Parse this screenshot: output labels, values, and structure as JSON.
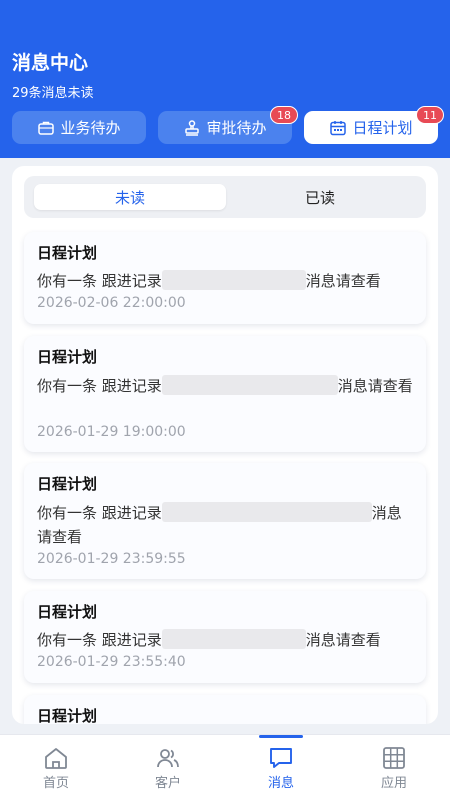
{
  "header": {
    "title": "消息中心",
    "subtitle": "29条消息未读"
  },
  "tabs": [
    {
      "label": "业务待办",
      "icon": "briefcase-icon",
      "badge": null,
      "active": false
    },
    {
      "label": "审批待办",
      "icon": "stamp-icon",
      "badge": "18",
      "active": false
    },
    {
      "label": "日程计划",
      "icon": "calendar-icon",
      "badge": "11",
      "active": true
    }
  ],
  "segment": {
    "unread": "未读",
    "read": "已读",
    "selected": "未读"
  },
  "messages": [
    {
      "title": "日程计划",
      "prefix": "你有一条 跟进记录",
      "suffix": "消息请查看",
      "time": "2026-02-06 22:00:00"
    },
    {
      "title": "日程计划",
      "prefix": "你有一条 跟进记录",
      "suffix": "消息请查看",
      "time": "2026-01-29 19:00:00"
    },
    {
      "title": "日程计划",
      "prefix": "你有一条 跟进记录",
      "suffix": "消息请查看",
      "time": "2026-01-29 23:59:55"
    },
    {
      "title": "日程计划",
      "prefix": "你有一条 跟进记录",
      "suffix": "消息请查看",
      "time": "2026-01-29 23:55:40"
    },
    {
      "title": "日程计划"
    }
  ],
  "nav": [
    {
      "label": "首页",
      "icon": "home-icon",
      "active": false
    },
    {
      "label": "客户",
      "icon": "users-icon",
      "active": false
    },
    {
      "label": "消息",
      "icon": "message-icon",
      "active": true
    },
    {
      "label": "应用",
      "icon": "grid-icon",
      "active": false
    }
  ],
  "colors": {
    "primary": "#2563eb",
    "badge": "#e84a55"
  }
}
